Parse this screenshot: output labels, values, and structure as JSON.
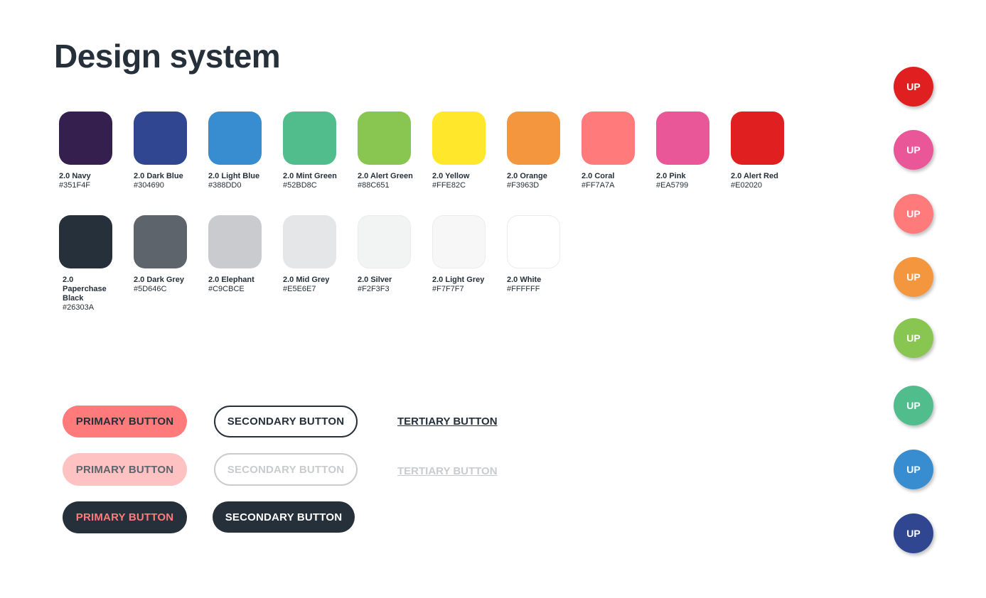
{
  "title": "Design system",
  "colors_row1": [
    {
      "name": "2.0 Navy",
      "hex": "#351F4F"
    },
    {
      "name": "2.0 Dark Blue",
      "hex": "#304690"
    },
    {
      "name": "2.0 Light Blue",
      "hex": "#388DD0"
    },
    {
      "name": "2.0 Mint Green",
      "hex": "#52BD8C"
    },
    {
      "name": "2.0 Alert Green",
      "hex": "#88C651"
    },
    {
      "name": "2.0 Yellow",
      "hex": "#FFE82C"
    },
    {
      "name": "2.0 Orange",
      "hex": "#F3963D"
    },
    {
      "name": "2.0 Coral",
      "hex": "#FF7A7A"
    },
    {
      "name": "2.0 Pink",
      "hex": "#EA5799"
    },
    {
      "name": "2.0 Alert Red",
      "hex": "#E02020"
    }
  ],
  "colors_row2": [
    {
      "name": "2.0 Paperchase Black",
      "hex": "#26303A"
    },
    {
      "name": "2.0 Dark Grey",
      "hex": "#5D646C"
    },
    {
      "name": "2.0 Elephant",
      "hex": "#C9CBCE"
    },
    {
      "name": "2.0 Mid Grey",
      "hex": "#E5E6E7"
    },
    {
      "name": "2.0 Silver",
      "hex": "#F2F3F3"
    },
    {
      "name": "2.0 Light Grey",
      "hex": "#F7F7F7"
    },
    {
      "name": "2.0 White",
      "hex": "#FFFFFF"
    }
  ],
  "buttons": {
    "primary_default": "PRIMARY BUTTON",
    "primary_disabled": "PRIMARY BUTTON",
    "primary_dark": "PRIMARY BUTTON",
    "secondary_default": "SECONDARY BUTTON",
    "secondary_disabled": "SECONDARY BUTTON",
    "secondary_dark": "SECONDARY BUTTON",
    "tertiary_default": "TERTIARY BUTTON",
    "tertiary_disabled": "TERTIARY BUTTON"
  },
  "up_buttons": [
    {
      "label": "UP",
      "color": "#E02020"
    },
    {
      "label": "UP",
      "color": "#EA5799"
    },
    {
      "label": "UP",
      "color": "#FF7A7A"
    },
    {
      "label": "UP",
      "color": "#F3963D"
    },
    {
      "label": "UP",
      "color": "#88C651"
    },
    {
      "label": "UP",
      "color": "#52BD8C"
    },
    {
      "label": "UP",
      "color": "#388DD0"
    },
    {
      "label": "UP",
      "color": "#304690"
    }
  ]
}
